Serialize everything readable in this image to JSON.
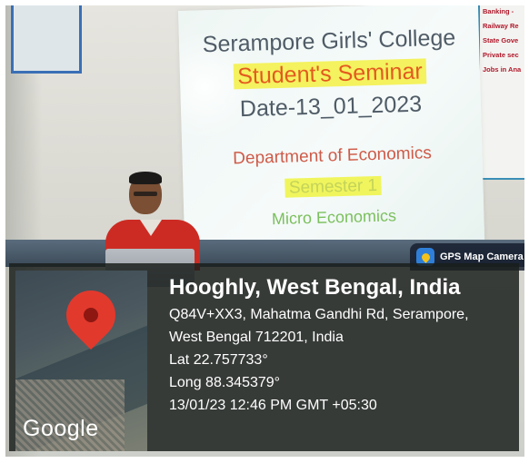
{
  "photo": {
    "slide": {
      "line1": "Serampore Girls' College",
      "line2": "Student's Seminar",
      "line3": "Date-13_01_2023",
      "line4": "Department of Economics",
      "line5": "Semester 1",
      "line6": "Micro  Economics"
    },
    "right_poster_items": [
      "Banking -",
      "Railway Re",
      "State Gove",
      "Private sec",
      "Jobs in Ana"
    ]
  },
  "gps_badge": {
    "label": "GPS Map Camera",
    "icon": "map-pin-icon"
  },
  "map_thumbnail": {
    "logo": "Google",
    "icon": "location-pin-icon"
  },
  "location": {
    "title": "Hooghly, West Bengal, India",
    "address_line1": "Q84V+XX3, Mahatma Gandhi Rd, Serampore,",
    "address_line2": "West Bengal 712201, India",
    "lat": "Lat 22.757733°",
    "long": "Long 88.345379°",
    "timestamp": "13/01/23 12:46 PM GMT +05:30"
  },
  "colors": {
    "slide_title": "#4f5b66",
    "slide_highlight_text": "#e35a1f",
    "slide_highlight_bg": "#f4f25e",
    "map_pin": "#e2392d",
    "overlay_bg": "#191e1c"
  }
}
